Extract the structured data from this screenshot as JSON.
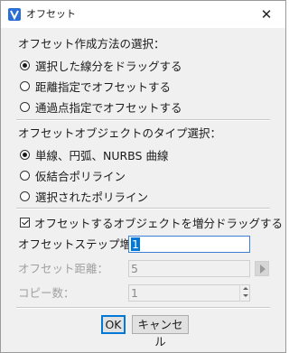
{
  "window": {
    "title": "オフセット",
    "close_glyph": "✕"
  },
  "creation_method": {
    "heading": "オフセット作成方法の選択：",
    "options": [
      {
        "label": "選択した線分をドラッグする",
        "selected": true
      },
      {
        "label": "距離指定でオフセットする",
        "selected": false
      },
      {
        "label": "通過点指定でオフセットする",
        "selected": false
      }
    ]
  },
  "object_type": {
    "heading": "オフセットオブジェクトのタイプ選択：",
    "options": [
      {
        "label": "単線、円弧、NURBS 曲線",
        "selected": true
      },
      {
        "label": "仮結合ポリライン",
        "selected": false
      },
      {
        "label": "選択されたポリライン",
        "selected": false
      }
    ]
  },
  "increment": {
    "checkbox_label": "オフセットするオブジェクトを増分ドラッグする",
    "checked": true
  },
  "fields": {
    "step_label": "オフセットステップ増分：",
    "step_value": "1",
    "distance_label": "オフセット距離：",
    "distance_value": "5",
    "copies_label": "コピー数：",
    "copies_value": "1"
  },
  "buttons": {
    "ok": "OK",
    "cancel": "キャンセル"
  },
  "colors": {
    "accent": "#0078d7",
    "dialog_bg": "#f0f0f0",
    "disabled_text": "#a0a0a0"
  },
  "icons": {
    "app": "app-logo-icon",
    "close": "close-icon",
    "distance_arrow": "play-arrow-icon",
    "spinner_up": "spin-up-icon",
    "spinner_down": "spin-down-icon"
  }
}
